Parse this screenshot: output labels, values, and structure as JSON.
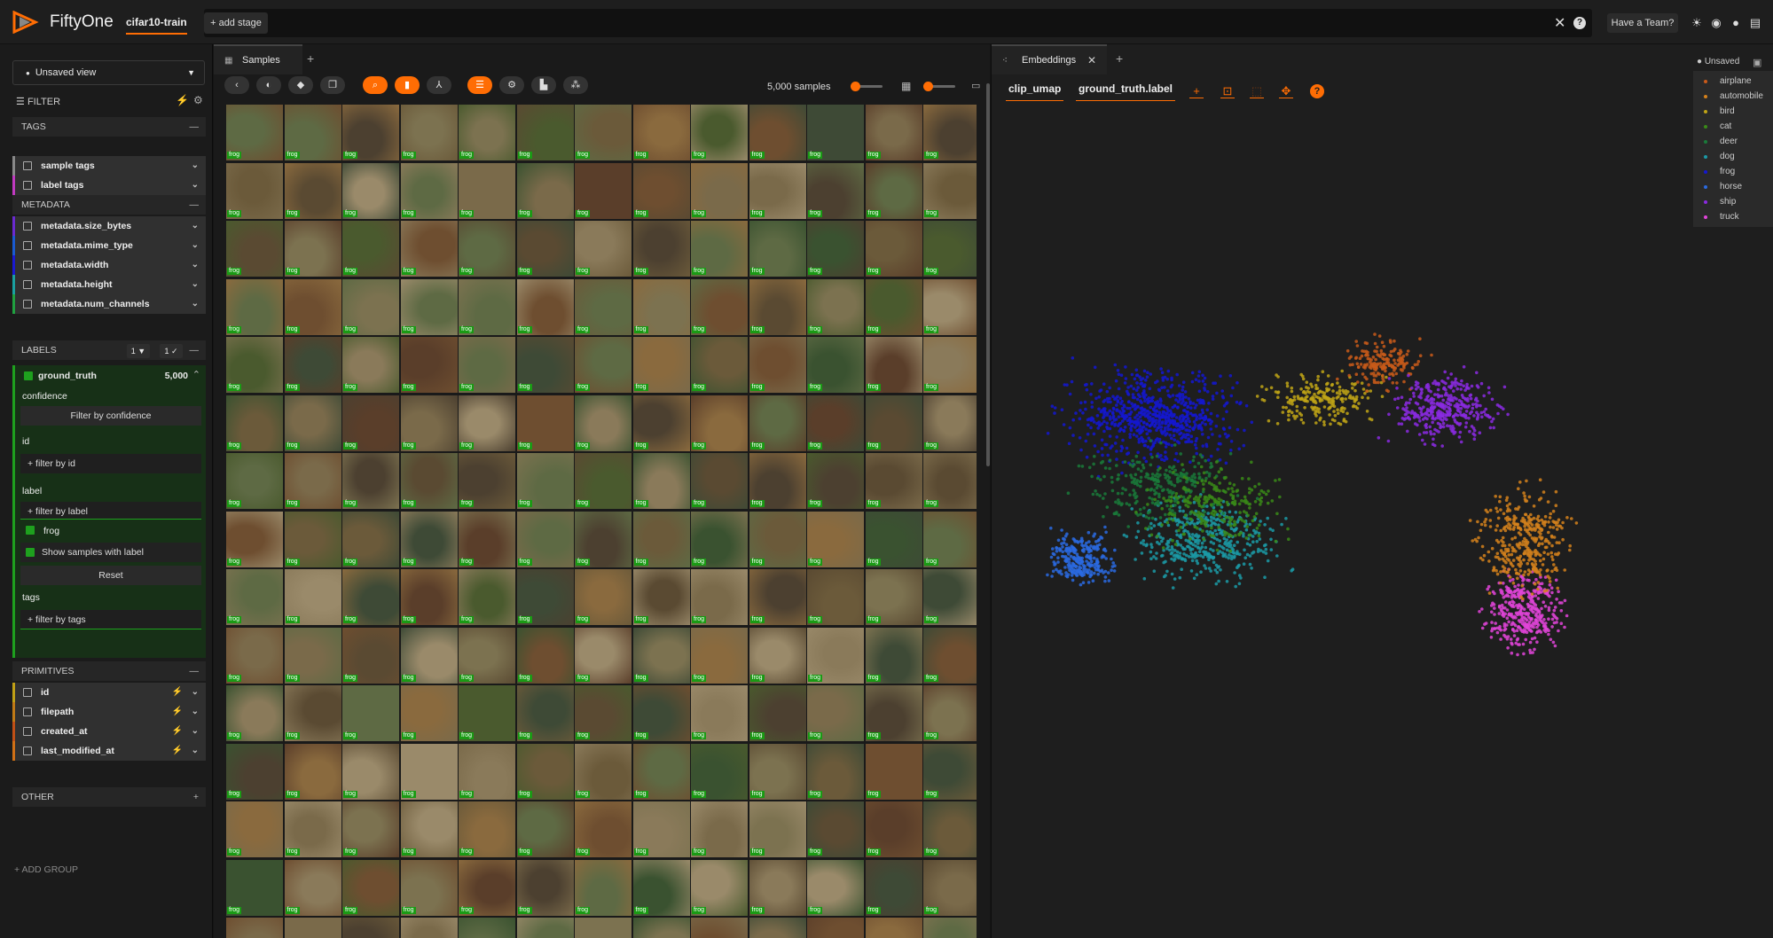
{
  "app": {
    "brand": "FiftyOne",
    "dataset": "cifar10-train",
    "add_stage": "+ add stage",
    "team_button": "Have a Team?"
  },
  "sidebar": {
    "view_select": "Unsaved view",
    "filter_label": "FILTER",
    "sections": {
      "tags": "TAGS",
      "metadata": "METADATA",
      "labels": "LABELS",
      "primitives": "PRIMITIVES",
      "other": "OTHER"
    },
    "tags_rows": [
      "sample tags",
      "label tags"
    ],
    "metadata_rows": [
      "metadata.size_bytes",
      "metadata.mime_type",
      "metadata.width",
      "metadata.height",
      "metadata.num_channels"
    ],
    "labels_pills": [
      "1 ▼",
      "1 ✓"
    ],
    "ground_truth": {
      "name": "ground_truth",
      "count": "5,000",
      "confidence_label": "confidence",
      "confidence_btn": "Filter by confidence",
      "id_label": "id",
      "id_placeholder": "+ filter by id",
      "label_label": "label",
      "label_placeholder": "+ filter by label",
      "selected_value": "frog",
      "show_samples": "Show samples with label",
      "reset": "Reset",
      "tags_label": "tags",
      "tags_placeholder": "+ filter by tags"
    },
    "primitive_rows": [
      "id",
      "filepath",
      "created_at",
      "last_modified_at"
    ],
    "add_group": "+ ADD GROUP"
  },
  "samples": {
    "tab": "Samples",
    "count_text": "5,000 samples",
    "tile_label": "frog"
  },
  "embeddings": {
    "tab": "Embeddings",
    "brain_key": "clip_umap",
    "color_by": "ground_truth.label",
    "unsaved": "Unsaved",
    "legend": [
      {
        "label": "airplane",
        "color": "#c85a1a"
      },
      {
        "label": "automobile",
        "color": "#d4811c"
      },
      {
        "label": "bird",
        "color": "#c0a416"
      },
      {
        "label": "cat",
        "color": "#3a8a18"
      },
      {
        "label": "deer",
        "color": "#1a7a3a"
      },
      {
        "label": "dog",
        "color": "#1b9aa6"
      },
      {
        "label": "frog",
        "color": "#1418d0"
      },
      {
        "label": "horse",
        "color": "#2a6ae0"
      },
      {
        "label": "ship",
        "color": "#8a2ae0"
      },
      {
        "label": "truck",
        "color": "#e044d8"
      }
    ]
  }
}
